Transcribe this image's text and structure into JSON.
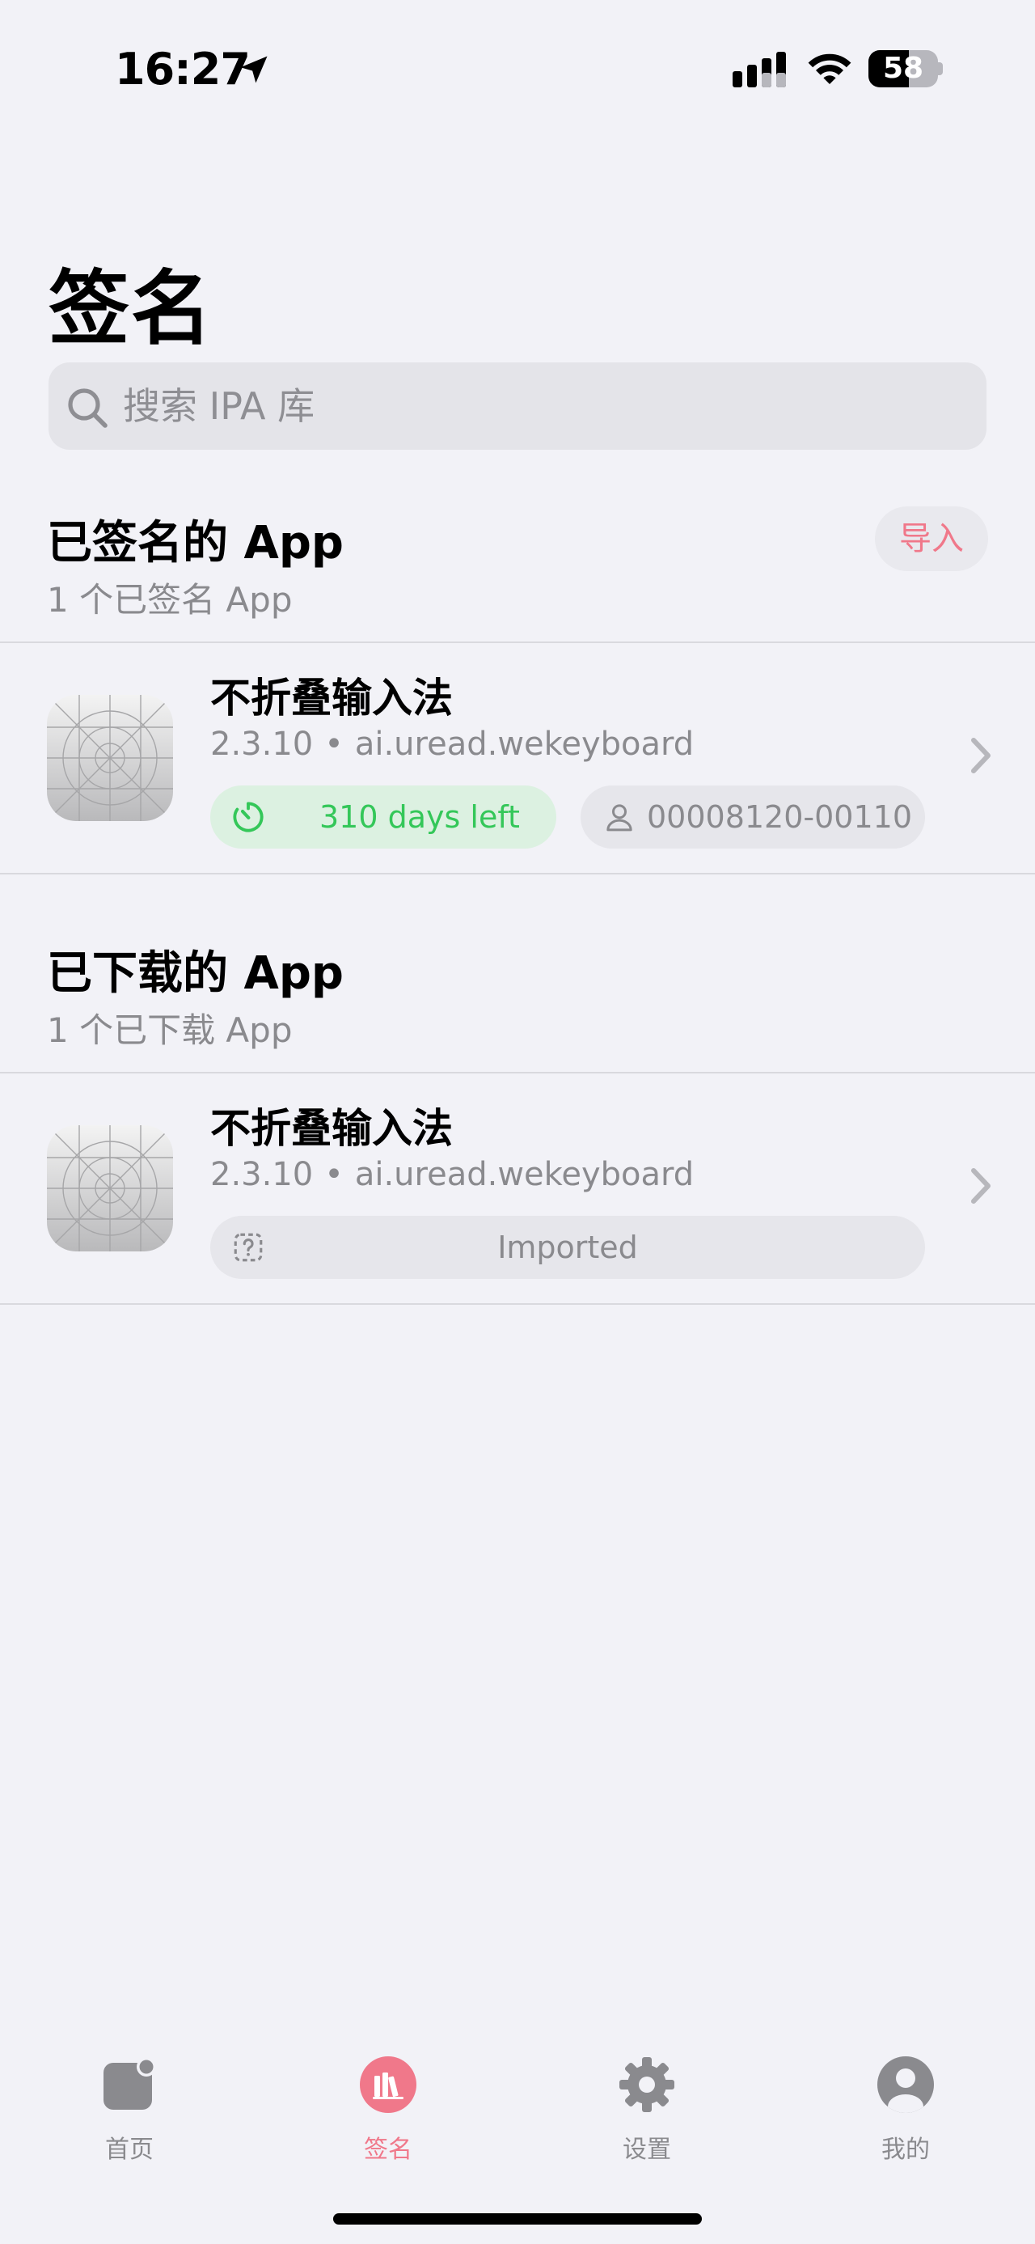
{
  "status_bar": {
    "time": "16:27",
    "battery": "58",
    "battery_level_percent": 58,
    "icons": [
      "location-arrow-icon",
      "cellular-signal-icon",
      "wifi-icon",
      "battery-icon"
    ]
  },
  "page": {
    "title": "签名"
  },
  "search": {
    "placeholder": "搜索 IPA 库",
    "value": ""
  },
  "signed_section": {
    "title": "已签名的 App",
    "subtitle": "1 个已签名 App",
    "import_label": "导入",
    "items": [
      {
        "name": "不折叠输入法",
        "version": "2.3.10",
        "bundle_id": "ai.uread.wekeyboard",
        "separator": "•",
        "days_left": "310 days left",
        "device": "00008120-00110..."
      }
    ]
  },
  "downloaded_section": {
    "title": "已下载的 App",
    "subtitle": "1 个已下载 App",
    "items": [
      {
        "name": "不折叠输入法",
        "version": "2.3.10",
        "bundle_id": "ai.uread.wekeyboard",
        "separator": "•",
        "status": "Imported"
      }
    ]
  },
  "tab_bar": {
    "active": "签名",
    "items": [
      {
        "label": "首页",
        "icon": "news-badge-icon"
      },
      {
        "label": "签名",
        "icon": "books-icon"
      },
      {
        "label": "设置",
        "icon": "gear-icon"
      },
      {
        "label": "我的",
        "icon": "person-circle-icon"
      }
    ]
  },
  "colors": {
    "accent": "#f0788a",
    "success": "#34c759",
    "background": "#f2f2f7",
    "secondary_text": "#8a8a8e"
  }
}
